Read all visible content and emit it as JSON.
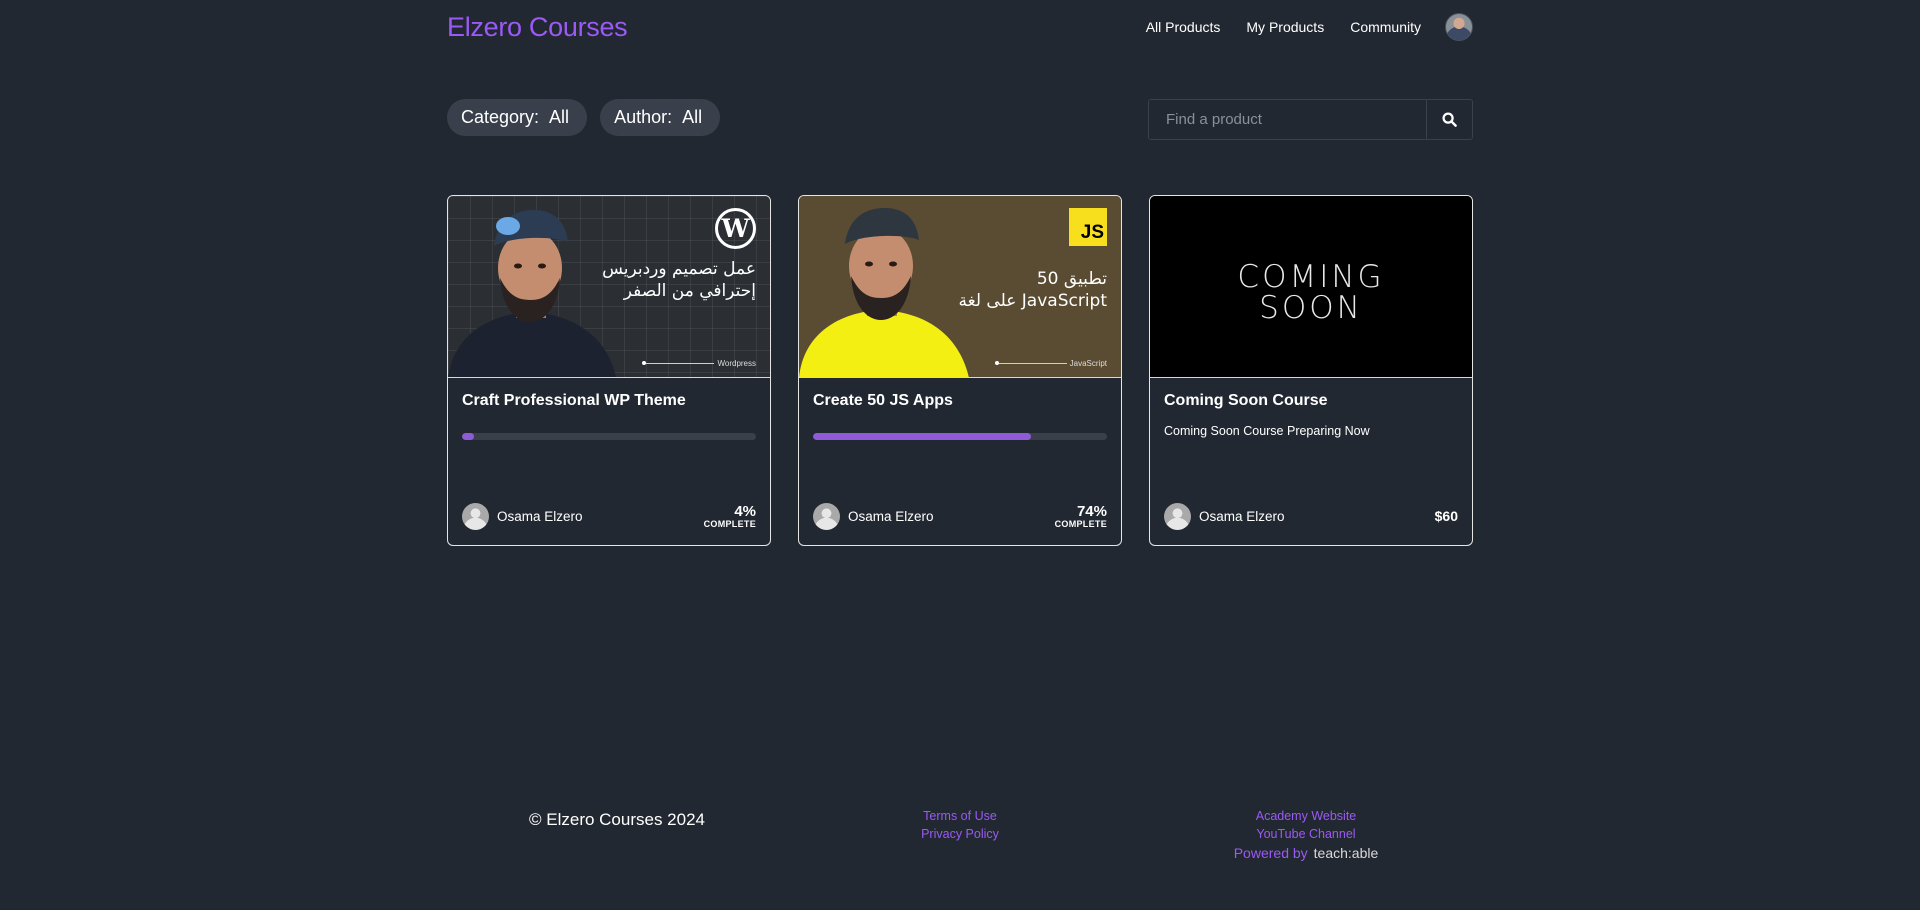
{
  "header": {
    "logo": "Elzero Courses",
    "nav": [
      "All Products",
      "My Products",
      "Community"
    ]
  },
  "filters": {
    "category_label": "Category:",
    "category_value": "All",
    "author_label": "Author:",
    "author_value": "All"
  },
  "search": {
    "placeholder": "Find a product"
  },
  "cards": [
    {
      "title": "Craft Professional WP Theme",
      "thumb_text_line1": "عمل تصميم وردبريس",
      "thumb_text_line2": "إحترافي من الصفر",
      "thumb_caption": "Wordpress",
      "progress": 4,
      "percent": "4%",
      "complete_label": "COMPLETE",
      "author": "Osama Elzero"
    },
    {
      "title": "Create 50 JS Apps",
      "thumb_text_line1": "50 تطبيق",
      "thumb_text_line2": "على لغة JavaScript",
      "thumb_caption": "JavaScript",
      "badge": "JS",
      "progress": 74,
      "percent": "74%",
      "complete_label": "COMPLETE",
      "author": "Osama Elzero"
    },
    {
      "title": "Coming Soon Course",
      "thumb_line1": "COMING",
      "thumb_line2": "SOON",
      "description": "Coming Soon Course Preparing Now",
      "author": "Osama Elzero",
      "price": "$60"
    }
  ],
  "footer": {
    "copyright": "© Elzero Courses 2024",
    "terms": "Terms of Use",
    "privacy": "Privacy Policy",
    "academy": "Academy Website",
    "youtube": "YouTube Channel",
    "powered_by": "Powered by",
    "powered_brand": "teach:able"
  },
  "colors": {
    "background": "#222831",
    "accent": "#9b59f5",
    "progress_fill": "#8f5bd6",
    "pill_bg": "#39404b"
  }
}
